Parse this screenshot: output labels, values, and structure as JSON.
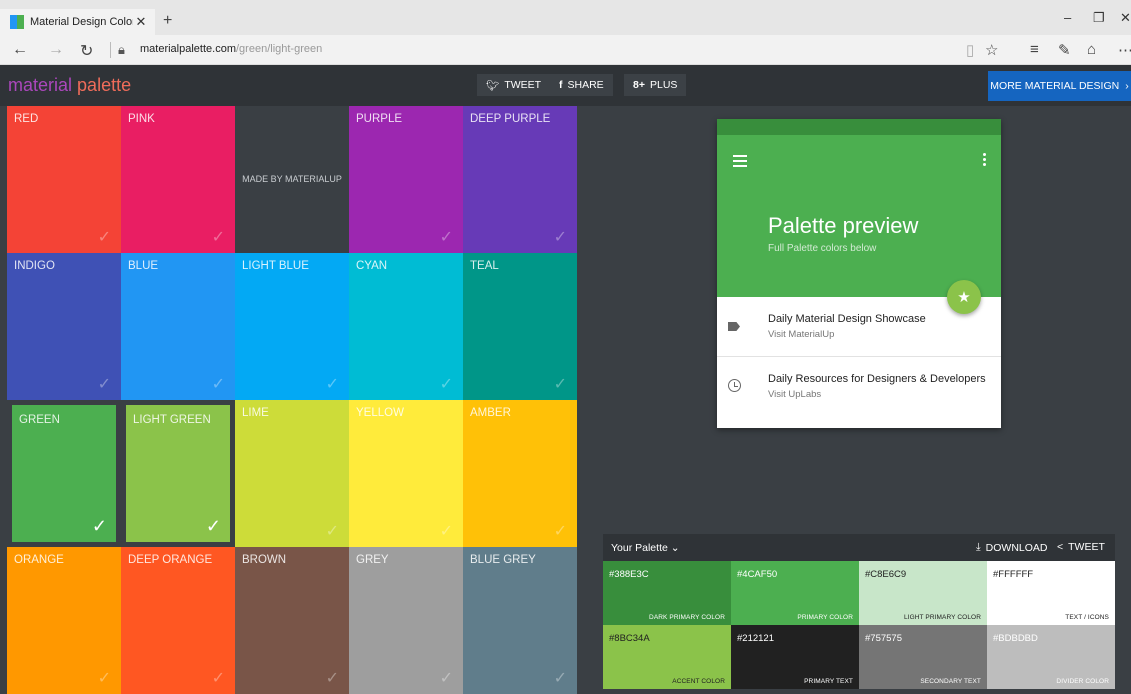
{
  "browser": {
    "tab_title": "Material Design Color P",
    "tab_close": "✕",
    "new_tab": "+",
    "url_domain": "materialpalette.com",
    "url_path": "/green/light-green"
  },
  "header": {
    "logo_material": "material",
    "logo_palette": "palette",
    "tweet": "TWEET",
    "share": "SHARE",
    "plus": "PLUS",
    "more": "MORE MATERIAL DESIGN"
  },
  "grid": {
    "made_by": "MADE BY MATERIALUP",
    "tiles": [
      {
        "name": "RED",
        "color": "#f44336"
      },
      {
        "name": "PINK",
        "color": "#e91e63"
      },
      {
        "name": "",
        "color": "#3a3f44"
      },
      {
        "name": "PURPLE",
        "color": "#9c27b0"
      },
      {
        "name": "DEEP PURPLE",
        "color": "#673ab7"
      },
      {
        "name": "INDIGO",
        "color": "#3f51b5"
      },
      {
        "name": "BLUE",
        "color": "#2196f3"
      },
      {
        "name": "LIGHT BLUE",
        "color": "#03a9f4"
      },
      {
        "name": "CYAN",
        "color": "#00bcd4"
      },
      {
        "name": "TEAL",
        "color": "#009688"
      },
      {
        "name": "GREEN",
        "color": "#4caf50"
      },
      {
        "name": "LIGHT GREEN",
        "color": "#8bc34a"
      },
      {
        "name": "LIME",
        "color": "#cddc39"
      },
      {
        "name": "YELLOW",
        "color": "#ffeb3b"
      },
      {
        "name": "AMBER",
        "color": "#ffc107"
      },
      {
        "name": "ORANGE",
        "color": "#ff9800"
      },
      {
        "name": "DEEP ORANGE",
        "color": "#ff5722"
      },
      {
        "name": "BROWN",
        "color": "#795548"
      },
      {
        "name": "GREY",
        "color": "#9e9e9e"
      },
      {
        "name": "BLUE GREY",
        "color": "#607d8b"
      }
    ]
  },
  "preview": {
    "title": "Palette preview",
    "subtitle": "Full Palette colors below",
    "item1_title": "Daily Material Design Showcase",
    "item1_sub": "Visit MaterialUp",
    "item2_title": "Daily Resources for Designers & Developers",
    "item2_sub": "Visit UpLabs"
  },
  "palette": {
    "title": "Your Palette",
    "download": "DOWNLOAD",
    "tweet": "TWEET",
    "swatches": [
      {
        "hex": "#388E3C",
        "role": "DARK PRIMARY COLOR",
        "bg": "#388e3c",
        "fg": "#ffffff"
      },
      {
        "hex": "#4CAF50",
        "role": "PRIMARY COLOR",
        "bg": "#4caf50",
        "fg": "#ffffff"
      },
      {
        "hex": "#C8E6C9",
        "role": "LIGHT PRIMARY COLOR",
        "bg": "#c8e6c9",
        "fg": "#212121"
      },
      {
        "hex": "#FFFFFF",
        "role": "TEXT / ICONS",
        "bg": "#ffffff",
        "fg": "#212121"
      },
      {
        "hex": "#8BC34A",
        "role": "ACCENT COLOR",
        "bg": "#8bc34a",
        "fg": "#212121"
      },
      {
        "hex": "#212121",
        "role": "PRIMARY TEXT",
        "bg": "#212121",
        "fg": "#ffffff"
      },
      {
        "hex": "#757575",
        "role": "SECONDARY TEXT",
        "bg": "#757575",
        "fg": "#ffffff"
      },
      {
        "hex": "#BDBDBD",
        "role": "DIVIDER COLOR",
        "bg": "#bdbdbd",
        "fg": "#ffffff"
      }
    ]
  }
}
